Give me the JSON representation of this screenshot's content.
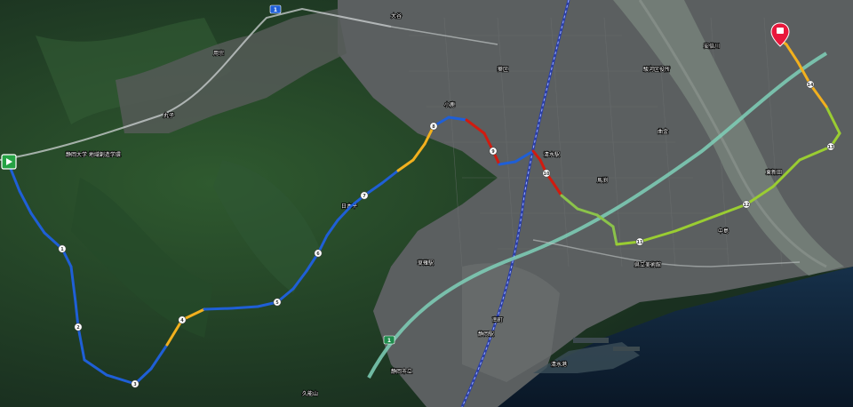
{
  "map": {
    "type": "satellite",
    "colors": {
      "forest": "#1f3a22",
      "forest_light": "#2f5a2f",
      "urban": "#5b5f60",
      "river": "#6f7a74",
      "sea": "#0d1f33",
      "expressway": "#7fd0b8",
      "railway": "#2b3fa8",
      "pin": "#e8183c"
    }
  },
  "route": {
    "start_icon": "play-icon",
    "end_icon": "map-pin-icon",
    "slow_color": "#1f5fd6",
    "mid_color": "#f2b01e",
    "fast_color": "#d11b0f",
    "km_markers": [
      "1",
      "2",
      "3",
      "4",
      "5",
      "6",
      "7",
      "8",
      "9",
      "10",
      "11",
      "12",
      "13",
      "14"
    ]
  },
  "road_badges": [
    "1",
    "1"
  ],
  "poi_labels": [
    "静岡大学 地域創造学環",
    "静岡駅",
    "清水駅",
    "草薙駅",
    "日本平",
    "久能山",
    "清水港",
    "県立美術館",
    "大谷",
    "駿河区役所",
    "静岡市立",
    "葵区",
    "用宗",
    "小鹿",
    "曲金",
    "安倍川",
    "丸子",
    "中島",
    "馬渕",
    "南町",
    "東新田"
  ]
}
